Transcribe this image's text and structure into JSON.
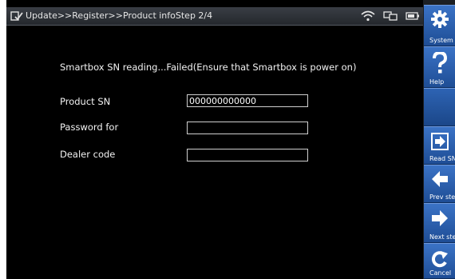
{
  "header": {
    "title": "Update>>Register>>Product infoStep 2/4",
    "icons": [
      "wifi-icon",
      "network-icon",
      "battery-icon"
    ]
  },
  "main": {
    "message": "Smartbox SN reading...Failed(Ensure that Smartbox is power on)",
    "fields": [
      {
        "label": "Product SN",
        "value": "000000000000"
      },
      {
        "label": "Password for",
        "value": ""
      },
      {
        "label": "Dealer code",
        "value": ""
      }
    ]
  },
  "sidebar": {
    "system_label": "System",
    "help_label": "Help",
    "read_label": "Read SN",
    "prev_label": "Prev step",
    "next_label": "Next step",
    "cancel_label": "Cancel"
  },
  "colors": {
    "accent": "#2a5fae",
    "background": "#000000"
  }
}
